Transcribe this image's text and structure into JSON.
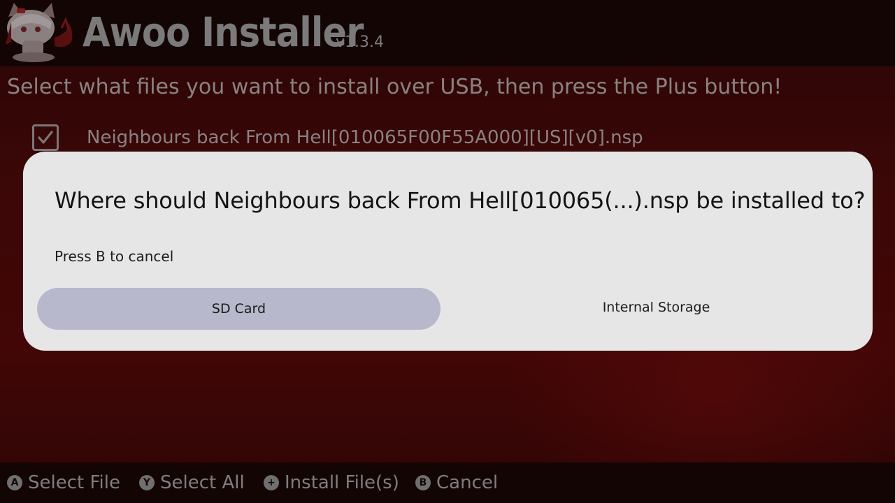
{
  "header": {
    "title": "Awoo Installer",
    "version": "v1.3.4",
    "logo_icon": "wolf-girl-mascot-icon"
  },
  "instruction": "Select what files you want to install over USB, then press the Plus button!",
  "files": [
    {
      "name": "Neighbours back From Hell[010065F00F55A000][US][v0].nsp",
      "checked": true
    }
  ],
  "dialog": {
    "title": "Where should Neighbours back From Hell[010065(...).nsp be installed to?",
    "subtitle": "Press B to cancel",
    "options": [
      {
        "label": "SD Card",
        "selected": true
      },
      {
        "label": "Internal Storage",
        "selected": false
      }
    ]
  },
  "footer": {
    "items": [
      {
        "glyph": "A",
        "label": "Select File"
      },
      {
        "glyph": "Y",
        "label": "Select All"
      },
      {
        "glyph": "+",
        "label": "Install File(s)"
      },
      {
        "glyph": "B",
        "label": "Cancel"
      }
    ]
  },
  "colors": {
    "background": "#3d0707",
    "header_bar": "#140505",
    "dialog_bg": "#e6e6e6",
    "selected_option": "#b8b8cc",
    "dim_text": "#8a8282"
  }
}
